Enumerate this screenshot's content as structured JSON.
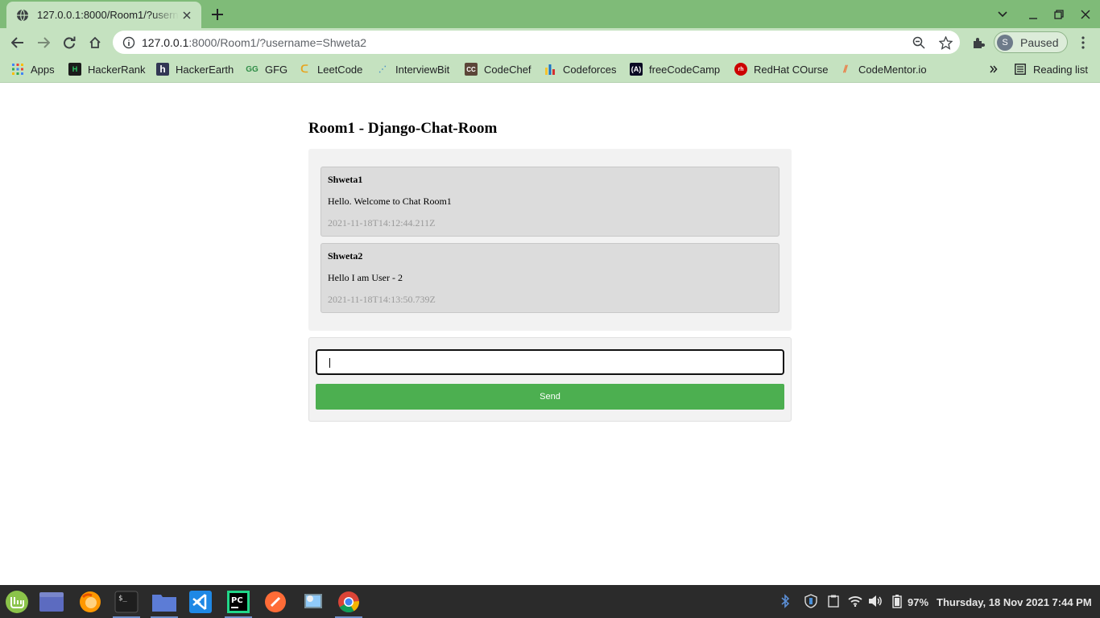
{
  "browser": {
    "tab_title": "127.0.0.1:8000/Room1/?username=Shweta2",
    "url_host": "127.0.0.1",
    "url_rest": ":8000/Room1/?username=Shweta2",
    "profile_initial": "S",
    "profile_label": "Paused",
    "bookmarks": [
      {
        "label": "Apps",
        "icon": "apps-grid-icon"
      },
      {
        "label": "HackerRank",
        "icon": "hackerrank-icon"
      },
      {
        "label": "HackerEarth",
        "icon": "hackerearth-icon"
      },
      {
        "label": "GFG",
        "icon": "gfg-icon"
      },
      {
        "label": "LeetCode",
        "icon": "leetcode-icon"
      },
      {
        "label": "InterviewBit",
        "icon": "interviewbit-icon"
      },
      {
        "label": "CodeChef",
        "icon": "codechef-icon"
      },
      {
        "label": "Codeforces",
        "icon": "codeforces-icon"
      },
      {
        "label": "freeCodeCamp",
        "icon": "freecodecamp-icon"
      },
      {
        "label": "RedHat COurse",
        "icon": "redhat-icon"
      },
      {
        "label": "CodeMentor.io",
        "icon": "codementor-icon"
      }
    ],
    "reading_list": "Reading list"
  },
  "chat": {
    "title": "Room1 - Django-Chat-Room",
    "messages": [
      {
        "user": "Shweta1",
        "text": "Hello. Welcome to Chat Room1",
        "time": "2021-11-18T14:12:44.211Z"
      },
      {
        "user": "Shweta2",
        "text": "Hello I am User - 2",
        "time": "2021-11-18T14:13:50.739Z"
      }
    ],
    "input_value": "",
    "send_label": "Send"
  },
  "taskbar": {
    "battery": "97%",
    "clock": "Thursday, 18 Nov 2021  7:44 PM"
  },
  "colors": {
    "tabstrip": "#7fbb78",
    "toolbar": "#c5e2c0",
    "send_button": "#4caf50",
    "message_bg": "#dcdcdc"
  }
}
